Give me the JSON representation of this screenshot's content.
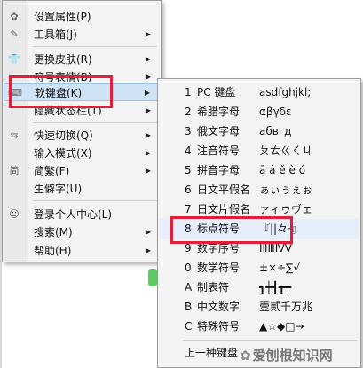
{
  "main_menu": {
    "items": [
      {
        "label": "设置属性(P)",
        "icon": "gear-icon",
        "submenu": false
      },
      {
        "label": "工具箱(J)",
        "icon": "wrench-icon",
        "submenu": true
      },
      {
        "label": "更换皮肤(R)",
        "icon": "shirt-icon",
        "submenu": true
      },
      {
        "label": "符号表情(B)",
        "icon": "",
        "submenu": true
      },
      {
        "label": "软键盘(K)",
        "icon": "keyboard-icon",
        "submenu": true
      },
      {
        "label": "隐藏状态栏(T)",
        "icon": "",
        "submenu": true
      },
      {
        "label": "快速切换(Q)",
        "icon": "switch-icon",
        "submenu": true
      },
      {
        "label": "输入模式(X)",
        "icon": "",
        "submenu": true
      },
      {
        "label": "简繁(F)",
        "icon": "simplified-traditional-icon",
        "submenu": true
      },
      {
        "label": "生僻字(U)",
        "icon": "",
        "submenu": false
      },
      {
        "label": "登录个人中心(L)",
        "icon": "user-icon",
        "submenu": false
      },
      {
        "label": "搜索(M)",
        "icon": "",
        "submenu": true
      },
      {
        "label": "帮助(H)",
        "icon": "",
        "submenu": true
      }
    ]
  },
  "soft_keyboard_menu": {
    "items": [
      {
        "num": "1",
        "name": "PC 键盘",
        "sample": "asdfghjkl;"
      },
      {
        "num": "2",
        "name": "希腊字母",
        "sample": "αβγδε"
      },
      {
        "num": "3",
        "name": "俄文字母",
        "sample": "абвгд"
      },
      {
        "num": "4",
        "name": "注音符号",
        "sample": "ㄆㄊㄍㄑㄐ"
      },
      {
        "num": "5",
        "name": "拼音字母",
        "sample": "ā á ě è ó"
      },
      {
        "num": "6",
        "name": "日文平假名",
        "sample": "ぁぃぅぇぉ"
      },
      {
        "num": "7",
        "name": "日文片假名",
        "sample": "ァィゥヴェ"
      },
      {
        "num": "8",
        "name": "标点符号",
        "sample": "『||々·』"
      },
      {
        "num": "9",
        "name": "数字序号",
        "sample": "ⅠⅡⅢⅣⅤ"
      },
      {
        "num": "0",
        "name": "数学符号",
        "sample": "±×÷∑√"
      },
      {
        "num": "A",
        "name": "制表符",
        "sample": "┓┿┫┳┯"
      },
      {
        "num": "B",
        "name": "中文数字",
        "sample": "壹贰千万兆"
      },
      {
        "num": "C",
        "name": "特殊符号",
        "sample": "▲☆◆□→"
      }
    ],
    "footer_item": "上一种键盘"
  },
  "watermark": "爱刨根知识网"
}
